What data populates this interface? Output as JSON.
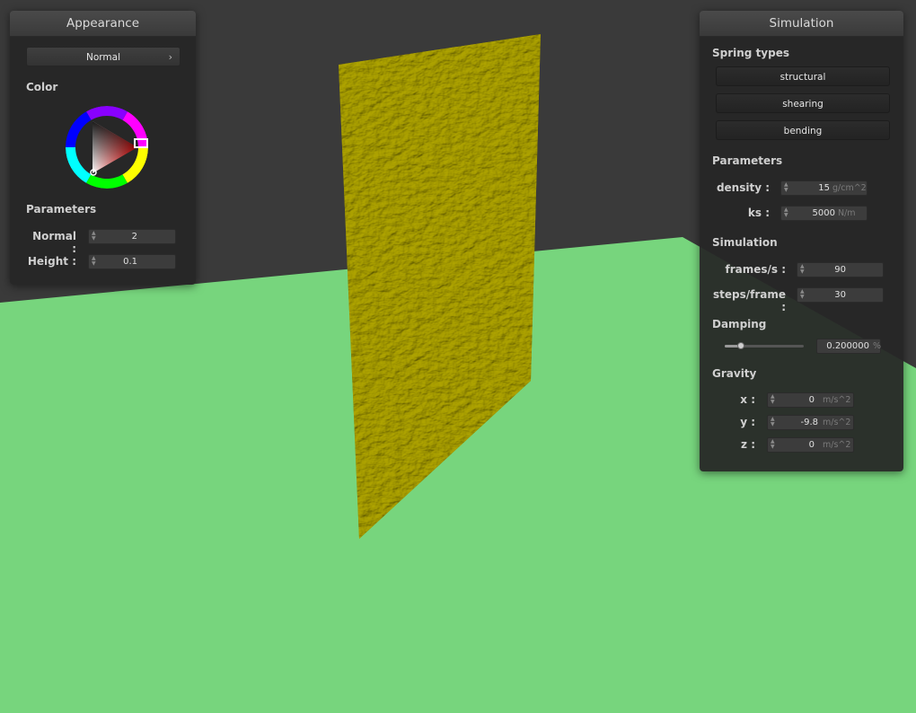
{
  "colors": {
    "background": "#3a3a3a",
    "floor": "#77d57d",
    "cloth": "#8a8100",
    "panel": "#262626"
  },
  "appearance": {
    "title": "Appearance",
    "shader_button": "Normal",
    "shader_arrow": "›",
    "color_label": "Color",
    "params_label": "Parameters",
    "normal_label": "Normal :",
    "normal_value": "2",
    "height_label": "Height :",
    "height_value": "0.1",
    "selected_color": "#ff0000"
  },
  "simulation": {
    "title": "Simulation",
    "spring_types_label": "Spring types",
    "springs": [
      "structural",
      "shearing",
      "bending"
    ],
    "params_label": "Parameters",
    "density_label": "density :",
    "density_value": "15",
    "density_unit": "g/cm^2",
    "ks_label": "ks :",
    "ks_value": "5000",
    "ks_unit": "N/m",
    "sim_label": "Simulation",
    "fps_label": "frames/s :",
    "fps_value": "90",
    "steps_label": "steps/frame :",
    "steps_value": "30",
    "damping_label": "Damping",
    "damping_fraction": 0.2,
    "damping_value": "0.200000",
    "damping_unit": "%",
    "gravity_label": "Gravity",
    "gx_label": "x :",
    "gx_value": "0",
    "gy_label": "y :",
    "gy_value": "-9.8",
    "gz_label": "z :",
    "gz_value": "0",
    "g_unit": "m/s^2"
  }
}
